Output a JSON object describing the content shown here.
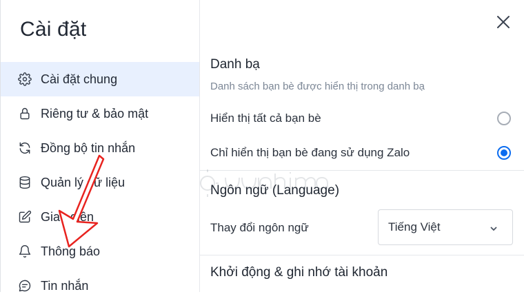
{
  "sidebar": {
    "title": "Cài đặt",
    "items": [
      {
        "label": "Cài đặt chung",
        "icon": "gear-icon",
        "active": true
      },
      {
        "label": "Riêng tư & bảo mật",
        "icon": "lock-icon",
        "active": false
      },
      {
        "label": "Đồng bộ tin nhắn",
        "icon": "sync-icon",
        "active": false
      },
      {
        "label": "Quản lý dữ liệu",
        "icon": "database-icon",
        "active": false
      },
      {
        "label": "Giao diện",
        "icon": "edit-icon",
        "active": false
      },
      {
        "label": "Thông báo",
        "icon": "bell-icon",
        "active": false
      },
      {
        "label": "Tin nhắn",
        "icon": "chat-icon",
        "active": false
      }
    ]
  },
  "main": {
    "contacts": {
      "title": "Danh bạ",
      "subtitle": "Danh sách bạn bè được hiển thị trong danh bạ",
      "options": [
        {
          "label": "Hiển thị tất cả bạn bè",
          "selected": false
        },
        {
          "label": "Chỉ hiển thị bạn bè đang sử dụng Zalo",
          "selected": true
        }
      ]
    },
    "language": {
      "title": "Ngôn ngữ (Language)",
      "row_label": "Thay đổi ngôn ngữ",
      "selected_value": "Tiếng Việt"
    },
    "startup": {
      "title": "Khởi động & ghi nhớ tài khoản"
    }
  },
  "colors": {
    "accent": "#0b6cf0",
    "active_bg": "#e8f0fe",
    "annotation_arrow": "#e8231f"
  }
}
